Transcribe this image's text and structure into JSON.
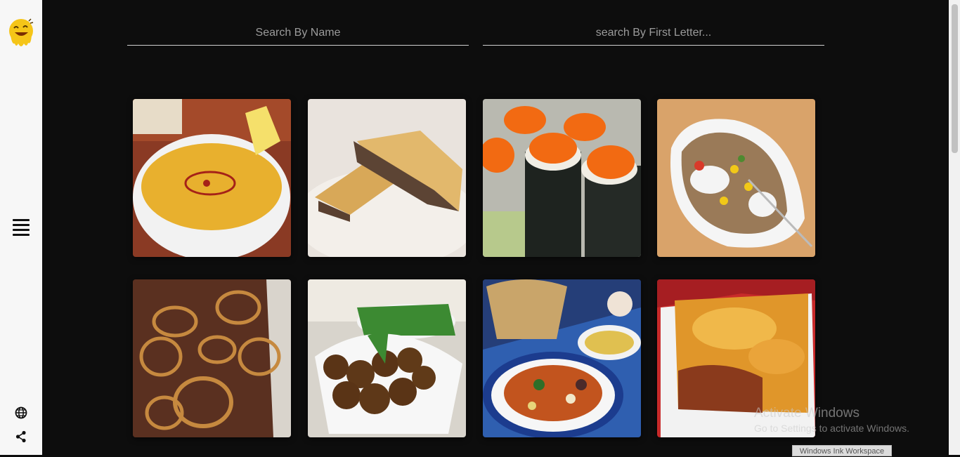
{
  "sidebar": {
    "logo_icon": "smiley-logo-icon",
    "menu_icon": "hamburger-menu-icon",
    "globe_icon": "globe-icon",
    "share_icon": "share-icon"
  },
  "search": {
    "by_name_placeholder": "Search By Name",
    "by_letter_placeholder": "search By First Letter..."
  },
  "meals": [
    {
      "image": "lentil-soup-photo"
    },
    {
      "image": "meat-pie-photo"
    },
    {
      "image": "sushi-rolls-photo"
    },
    {
      "image": "stuffed-baked-potato-photo"
    },
    {
      "image": "beef-with-onions-photo"
    },
    {
      "image": "falafel-plate-photo"
    },
    {
      "image": "vegetable-salad-plate-photo"
    },
    {
      "image": "lasagna-photo"
    }
  ],
  "watermark": {
    "title": "Activate Windows",
    "subtitle": "Go to Settings to activate Windows."
  },
  "taskbar_tab": "Windows Ink Workspace",
  "colors": {
    "background": "#0d0d0d",
    "sidebar": "#f7f7f7",
    "logo_yellow": "#f5c518"
  }
}
